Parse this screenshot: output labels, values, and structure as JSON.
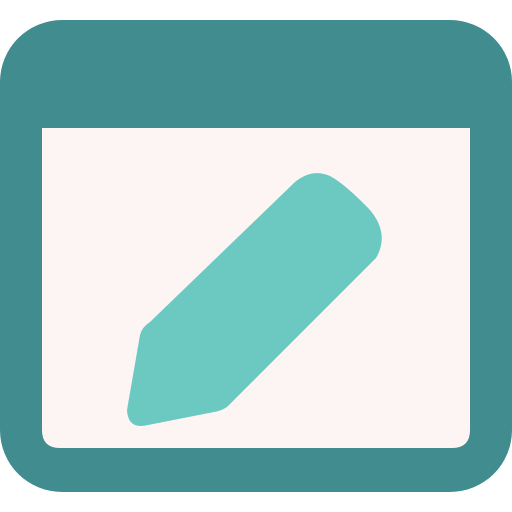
{
  "icon": {
    "name": "edit-window-icon",
    "frame_color": "#408c8f",
    "canvas_color": "#fdf5f3",
    "pencil_color": "#6bc9c2"
  }
}
